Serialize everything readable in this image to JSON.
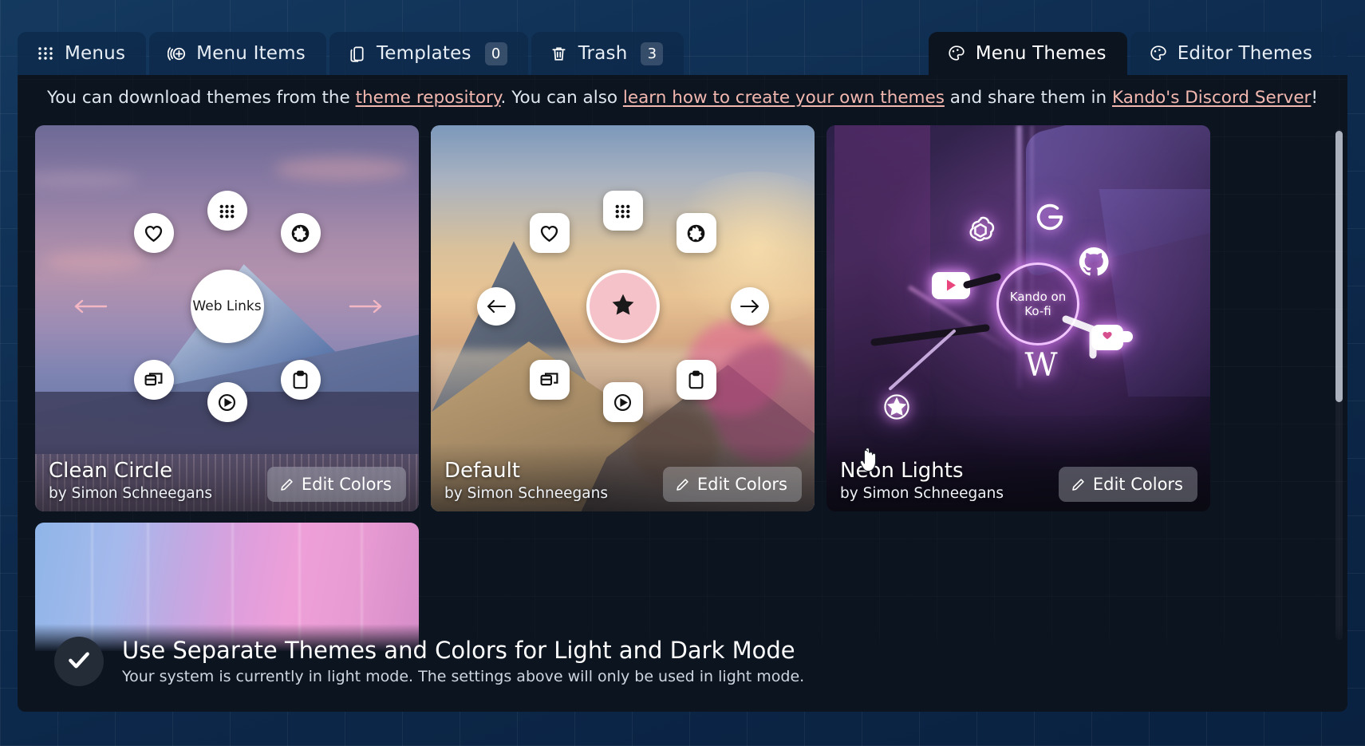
{
  "tabs": {
    "left": [
      {
        "label": "Menus",
        "icon": "grid-icon",
        "badge": null,
        "active": false
      },
      {
        "label": "Menu Items",
        "icon": "add-node-icon",
        "badge": null,
        "active": false
      },
      {
        "label": "Templates",
        "icon": "copy-icon",
        "badge": "0",
        "active": false
      },
      {
        "label": "Trash",
        "icon": "trash-icon",
        "badge": "3",
        "active": false
      }
    ],
    "right": [
      {
        "label": "Menu Themes",
        "icon": "palette-icon",
        "badge": null,
        "active": true
      },
      {
        "label": "Editor Themes",
        "icon": "palette-icon",
        "badge": null,
        "active": false
      }
    ]
  },
  "banner": {
    "part1": "You can download themes from the ",
    "link1": "theme repository",
    "part2": ". You can also ",
    "link2": "learn how to create your own themes",
    "part3": " and share them in ",
    "link3": "Kando's Discord Server",
    "part4": "!"
  },
  "themes": [
    {
      "name": "Clean Circle",
      "author": "by Simon Schneegans",
      "edit_label": "Edit Colors",
      "selected": false,
      "center_label": "Web Links"
    },
    {
      "name": "Default",
      "author": "by Simon Schneegans",
      "edit_label": "Edit Colors",
      "selected": true,
      "center_label": ""
    },
    {
      "name": "Neon Lights",
      "author": "by Simon Schneegans",
      "edit_label": "Edit Colors",
      "selected": false,
      "center_label": "Kando on\nKo-fi",
      "center_line1": "Kando on",
      "center_line2": "Ko-fi"
    }
  ],
  "dark_mode_option": {
    "title": "Use Separate Themes and Colors for Light and Dark Mode",
    "description": "Your system is currently in light mode. The settings above will only be used in light mode.",
    "checked": true
  },
  "colors": {
    "accent_link": "#f2b7ae",
    "panel_bg": "#0c1420",
    "desktop_bg": "#0b2544",
    "tab_inactive": "#0e2a4a",
    "neon": "#f3c7ff",
    "default_center": "#f6c2c9"
  }
}
